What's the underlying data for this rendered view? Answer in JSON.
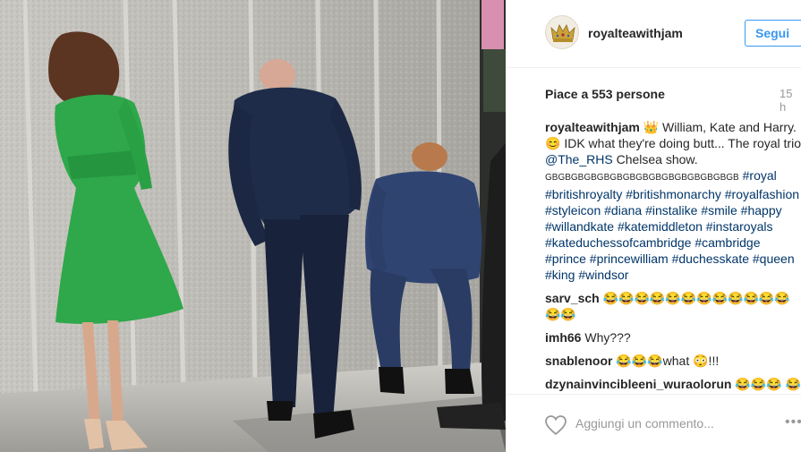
{
  "post": {
    "username": "royalteawithjam",
    "follow_label": "Segui",
    "likes_text": "Piace a 553 persone",
    "time_text": "15 h",
    "caption": {
      "user": "royalteawithjam",
      "text_1": "👑 William, Kate and Harry. 😊 IDK what they're doing butt... The royal trio ",
      "mention": "@The_RHS",
      "text_2": " Chelsea show.",
      "gb_run": "GBGBGBGBGBGBGBGBGBGBGBGBGBGBGB",
      "hashtags": "#royal #britishroyalty #britishmonarchy #royalfashion #styleicon #diana #instalike #smile #happy #willandkate #katemiddleton #instaroyals #kateduchessofcambridge #cambridge #prince #princewilliam #duchesskate #queen #king #windsor"
    },
    "comments": [
      {
        "user": "sarv_sch",
        "text": "😂😂😂😂😂😂😂😂😂😂😂😂😂😂"
      },
      {
        "user": "imh66",
        "text": "Why???"
      },
      {
        "user": "snablenoor",
        "text": "😂😂😂what 😳!!!"
      },
      {
        "user": "dzynainvincibleeni_wuraolorun",
        "text": "😂😂😂 😂 whatever the ROYALTRIO are doing"
      }
    ],
    "comment_placeholder": "Aggiungi un commento...",
    "more_glyph": "•••"
  },
  "icons": {
    "heart": "heart-icon",
    "avatar": "crown-avatar-icon"
  },
  "colors": {
    "accent": "#3897f0",
    "hashtag": "#003569",
    "dress": "#2ea84a"
  }
}
